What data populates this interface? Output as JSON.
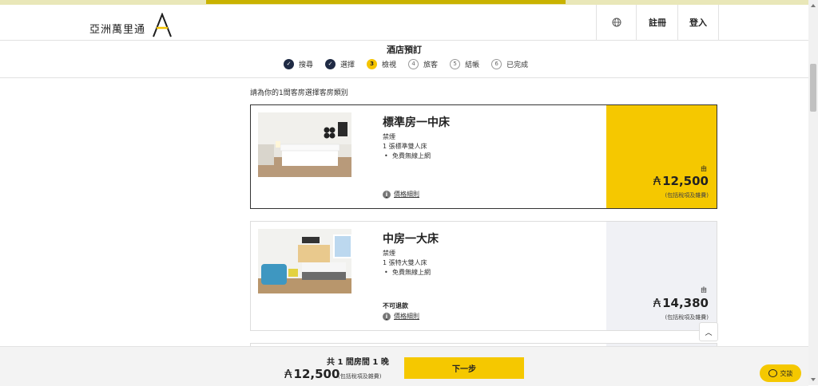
{
  "header": {
    "logo_text": "亞洲萬里通",
    "register": "註冊",
    "login": "登入"
  },
  "page_title": "酒店預訂",
  "steps": [
    {
      "num": "",
      "label": "搜尋",
      "state": "done"
    },
    {
      "num": "",
      "label": "選擇",
      "state": "done"
    },
    {
      "num": "3",
      "label": "檢視",
      "state": "current"
    },
    {
      "num": "4",
      "label": "旅客",
      "state": "todo"
    },
    {
      "num": "5",
      "label": "結帳",
      "state": "todo"
    },
    {
      "num": "6",
      "label": "已完成",
      "state": "todo"
    }
  ],
  "instruction": "請為你的1間客房選擇客房類別",
  "currency_symbol": "₳",
  "rooms": [
    {
      "name": "標準房一中床",
      "smoking": "禁煙",
      "bed": "1 張標準雙人床",
      "amenity": "免費無線上網",
      "non_refundable": "",
      "detail_link": "價格細則",
      "from": "由",
      "price": "12,500",
      "price_note": "(包括稅項及雜費)"
    },
    {
      "name": "中房一大床",
      "smoking": "禁煙",
      "bed": "1 張特大雙人床",
      "amenity": "免費無線上網",
      "non_refundable": "不可退款",
      "detail_link": "價格細則",
      "from": "由",
      "price": "14,380",
      "price_note": "(包括稅項及雜費)"
    }
  ],
  "footer": {
    "summary": "共 1 間房間 1 晚",
    "total": "12,500",
    "total_note": "(包括稅項及雜費)",
    "next_button": "下一步"
  },
  "chat": {
    "label": "交談"
  },
  "colors": {
    "accent": "#f5c800",
    "navy": "#1f2a44"
  }
}
